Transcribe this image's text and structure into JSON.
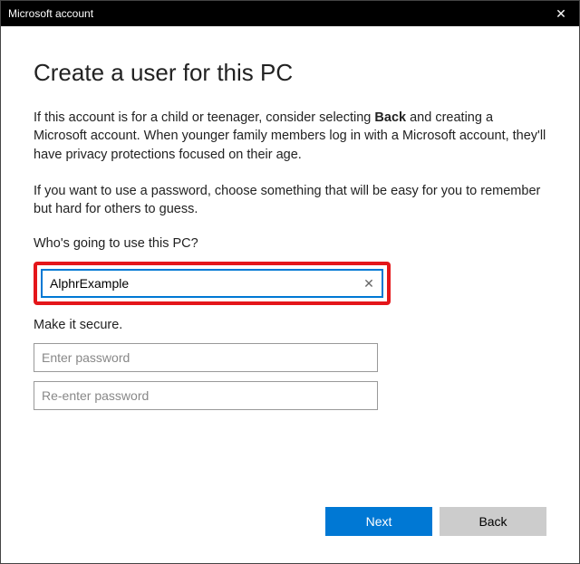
{
  "window": {
    "title": "Microsoft account"
  },
  "header": {
    "heading": "Create a user for this PC"
  },
  "paragraphs": {
    "p1_pre": "If this account is for a child or teenager, consider selecting ",
    "p1_bold": "Back",
    "p1_post": " and creating a Microsoft account. When younger family members log in with a Microsoft account, they'll have privacy protections focused on their age.",
    "p2": "If you want to use a password, choose something that will be easy for you to remember but hard for others to guess."
  },
  "form": {
    "username_label": "Who's going to use this PC?",
    "username_value": "AlphrExample",
    "secure_label": "Make it secure.",
    "password1_placeholder": "Enter password",
    "password2_placeholder": "Re-enter password"
  },
  "buttons": {
    "next": "Next",
    "back": "Back"
  }
}
